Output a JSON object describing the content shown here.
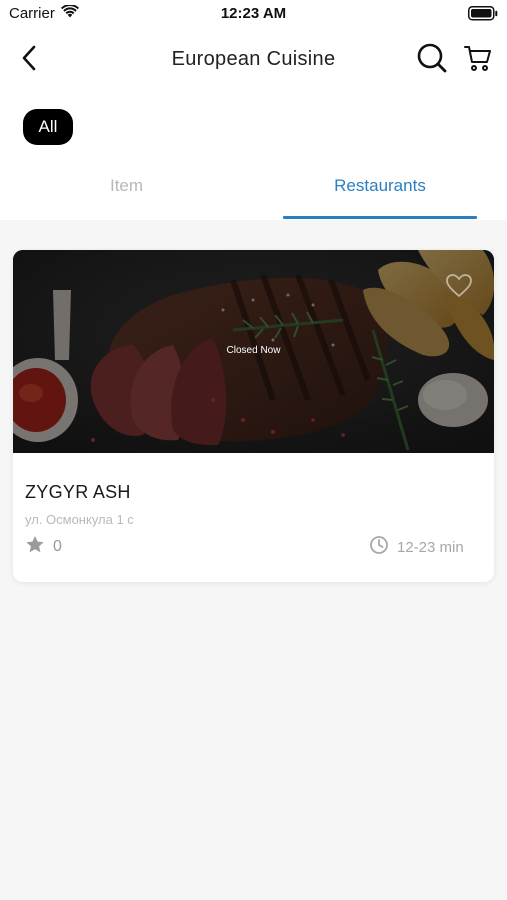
{
  "status_bar": {
    "carrier": "Carrier",
    "time": "12:23 AM"
  },
  "header": {
    "title": "European Cuisine",
    "back_icon": "chevron-left-icon",
    "search_icon": "search-icon",
    "cart_icon": "cart-icon"
  },
  "filters": {
    "chips": [
      "All"
    ],
    "selected": "All"
  },
  "tabs": [
    {
      "label": "Item",
      "active": false
    },
    {
      "label": "Restaurants",
      "active": true
    }
  ],
  "restaurants": [
    {
      "status": "Closed Now",
      "name": "ZYGYR ASH",
      "address": "ул. Осмонкула 1 с",
      "rating": "0",
      "delivery_time": "12-23 min",
      "favorite": false
    }
  ],
  "colors": {
    "accent": "#2a7fc0",
    "chip_bg": "#000000",
    "inactive_tab": "#b8b8b8",
    "page_bg": "#f6f6f6"
  }
}
